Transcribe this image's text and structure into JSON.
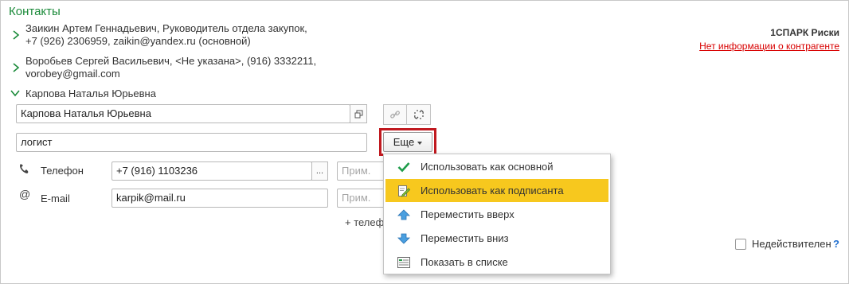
{
  "section": {
    "title": "Контакты"
  },
  "contacts": [
    {
      "line1": "Заикин Артем Геннадьевич, Руководитель отдела закупок,",
      "line2": "+7 (926) 2306959, zaikin@yandex.ru (основной)"
    },
    {
      "line1": "Воробьев Сергей Васильевич, <Не указана>, (916) 3332211,",
      "line2": "vorobey@gmail.com"
    }
  ],
  "expanded_contact": {
    "header": "Карпова Наталья Юрьевна",
    "name_value": "Карпова Наталья Юрьевна",
    "position_value": "логист",
    "phone": {
      "label": "Телефон",
      "value": "+7 (916) 1103236",
      "ellipsis": "...",
      "note_placeholder": "Прим."
    },
    "email": {
      "label": "E-mail",
      "value": "karpik@mail.ru",
      "note_placeholder": "Прим."
    },
    "add_link": "+ телеф"
  },
  "risks": {
    "title": "1СПАРК Риски",
    "link": "Нет информации о контрагенте"
  },
  "more_button": {
    "label": "Еще"
  },
  "menu": {
    "items": [
      {
        "label": "Использовать как основной",
        "icon": "checkmark-icon",
        "active": false
      },
      {
        "label": "Использовать как подписанта",
        "icon": "sign-document-icon",
        "active": true
      },
      {
        "label": "Переместить вверх",
        "icon": "arrow-up-icon",
        "active": false
      },
      {
        "label": "Переместить вниз",
        "icon": "arrow-down-icon",
        "active": false
      },
      {
        "label": "Показать в списке",
        "icon": "list-icon",
        "active": false
      }
    ]
  },
  "inactive": {
    "label": "Недействителен",
    "checked": false,
    "help": "?"
  },
  "colors": {
    "accent_green": "#1b8a3a",
    "highlight": "#f7c81e",
    "link_red": "#d80000",
    "outline_red": "#c0191f"
  }
}
